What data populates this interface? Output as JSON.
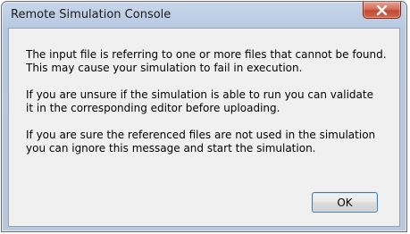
{
  "window": {
    "title": "Remote Simulation Console",
    "close_icon": "close-icon"
  },
  "message": {
    "paragraph_1_line_1": "The input file is referring to one or more files that cannot be found.",
    "paragraph_1_line_2": "This may cause your simulation to fail in execution.",
    "paragraph_2_line_1": "If you are unsure if the simulation is able to run you can validate",
    "paragraph_2_line_2": "it in the corresponding editor before uploading.",
    "paragraph_3_line_1": "If you are sure the referenced files are not used in the simulation",
    "paragraph_3_line_2": "you can ignore this message and start the simulation."
  },
  "buttons": {
    "ok_label": "OK"
  },
  "colors": {
    "close_button": "#c7503a",
    "ok_button_border": "#3c7fb1",
    "frame": "#b9cbe2"
  }
}
